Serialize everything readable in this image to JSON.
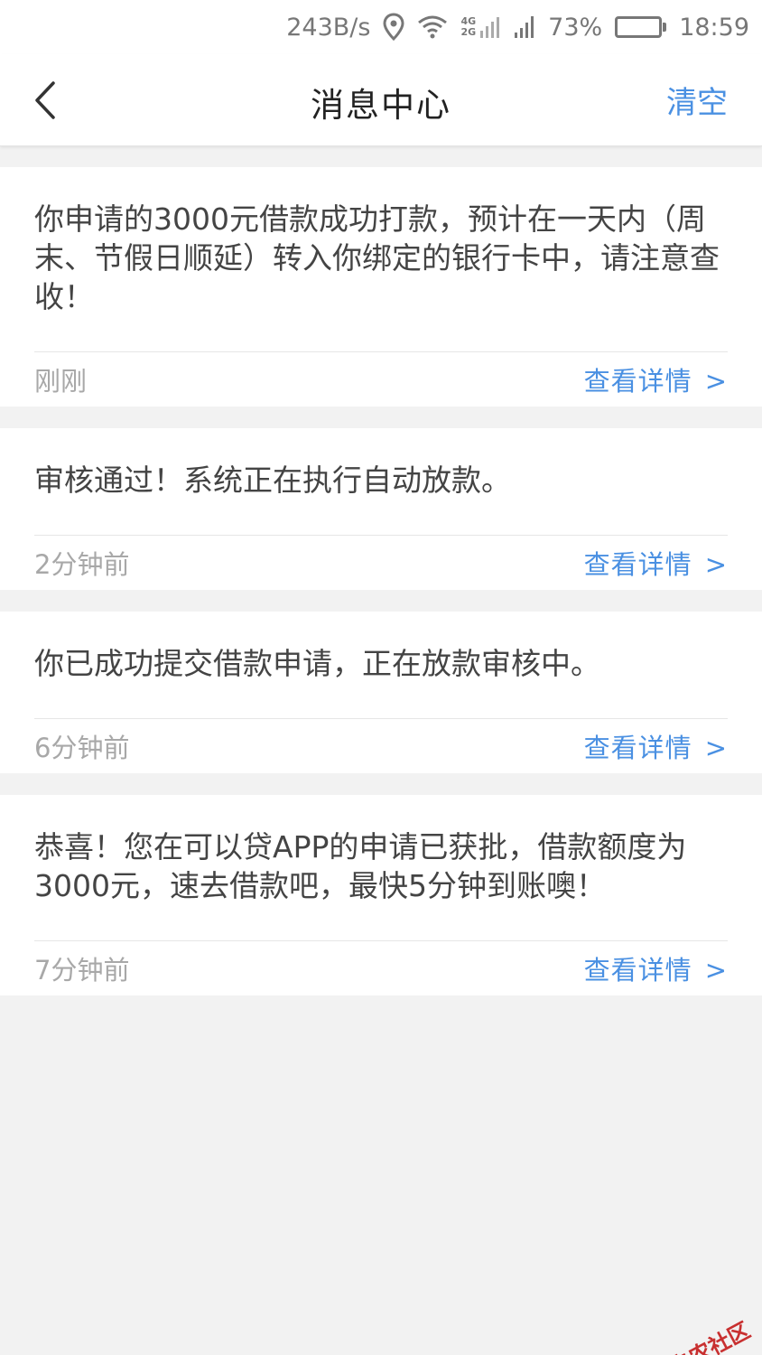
{
  "status_bar": {
    "net_speed": "243B/s",
    "network_badge_top": "4G",
    "network_badge_bottom": "2G",
    "battery": "73%",
    "battery_level": 0.73,
    "time": "18:59",
    "icons": [
      "location-icon",
      "wifi-icon",
      "signal-icon",
      "battery-icon"
    ]
  },
  "nav": {
    "title": "消息中心",
    "clear_label": "清空",
    "back_icon": "chevron-left-icon"
  },
  "messages": [
    {
      "text": "你申请的3000元借款成功打款，预计在一天内（周末、节假日顺延）转入你绑定的银行卡中，请注意查收！",
      "time": "刚刚",
      "link": "查看详情",
      "chevron": ">"
    },
    {
      "text": "审核通过！系统正在执行自动放款。",
      "time": "2分钟前",
      "link": "查看详情",
      "chevron": ">"
    },
    {
      "text": "你已成功提交借款申请，正在放款审核中。",
      "time": "6分钟前",
      "link": "查看详情",
      "chevron": ">"
    },
    {
      "text": "恭喜！您在可以贷APP的申请已获批，借款额度为3000元，速去借款吧，最快5分钟到账噢！",
      "time": "7分钟前",
      "link": "查看详情",
      "chevron": ">"
    }
  ],
  "watermark": {
    "text": "卡农社区"
  },
  "colors": {
    "accent": "#4a90e2",
    "background": "#f2f2f2",
    "card": "#ffffff",
    "text": "#444444",
    "muted": "#a8a8a8",
    "battery": "#5ec45e"
  }
}
